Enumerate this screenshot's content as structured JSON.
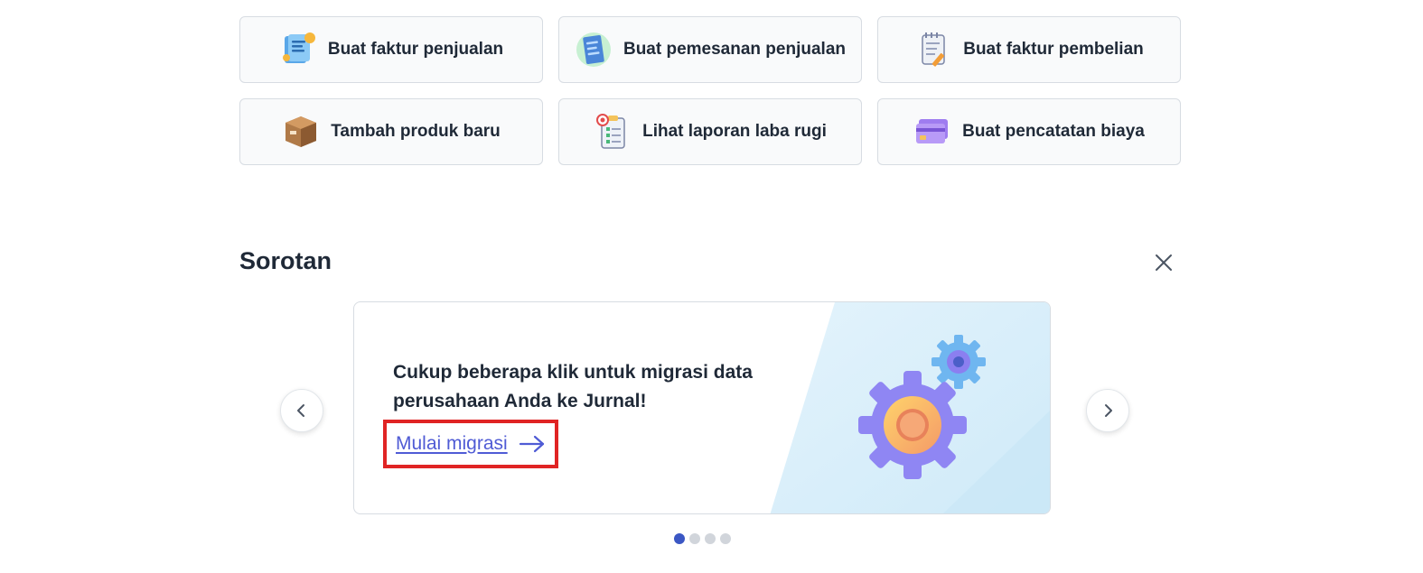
{
  "quick_actions": [
    {
      "label": "Buat faktur penjualan",
      "icon": "sales-invoice-icon"
    },
    {
      "label": "Buat pemesanan penjualan",
      "icon": "sales-order-icon"
    },
    {
      "label": "Buat faktur pembelian",
      "icon": "purchase-invoice-icon"
    },
    {
      "label": "Tambah produk baru",
      "icon": "product-box-icon"
    },
    {
      "label": "Lihat laporan laba rugi",
      "icon": "report-clipboard-icon"
    },
    {
      "label": "Buat pencatatan biaya",
      "icon": "expense-card-icon"
    }
  ],
  "highlights": {
    "title": "Sorotan",
    "card": {
      "headline": "Cukup beberapa klik untuk migrasi data perusahaan Anda ke Jurnal!",
      "cta_label": "Mulai migrasi"
    },
    "total_slides": 4,
    "active_slide": 1
  },
  "colors": {
    "accent_link": "#4f5bd5",
    "highlight_box": "#e02424",
    "dot_active": "#3b57c4",
    "dot_inactive": "#d1d5db"
  }
}
